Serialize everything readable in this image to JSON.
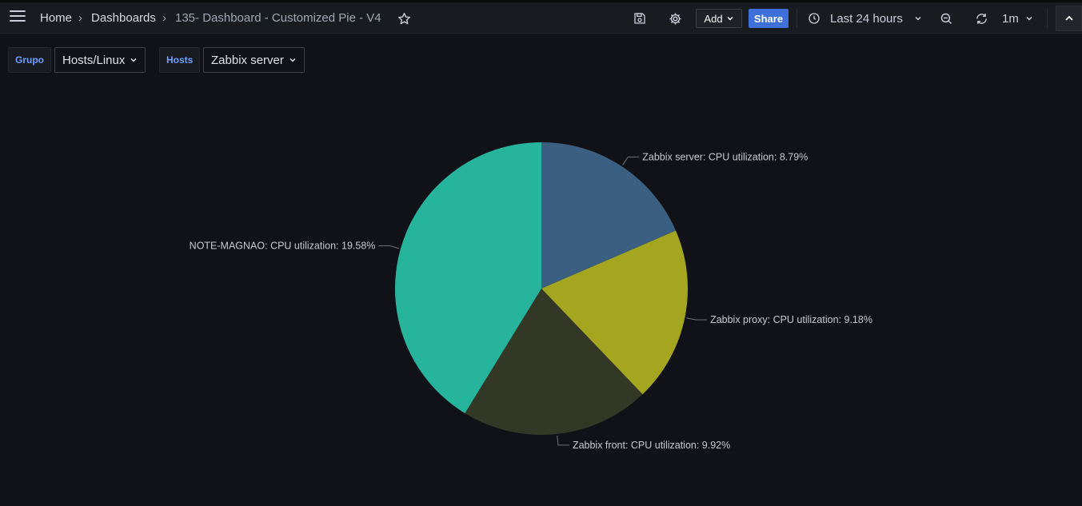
{
  "header": {
    "breadcrumb": {
      "home": "Home",
      "dashboards": "Dashboards",
      "current": "135- Dashboard - Customized Pie - V4"
    },
    "add_label": "Add",
    "share_label": "Share",
    "time_range": "Last 24 hours",
    "refresh_interval": "1m",
    "icons": [
      "menu-icon",
      "star-icon",
      "save-icon",
      "gear-icon",
      "clock-icon",
      "zoom-out-icon",
      "refresh-icon",
      "chevron-up-icon"
    ]
  },
  "variables": [
    {
      "label": "Grupo",
      "value": "Hosts/Linux"
    },
    {
      "label": "Hosts",
      "value": "Zabbix server"
    }
  ],
  "chart_data": {
    "type": "pie",
    "slices": [
      {
        "label": "Zabbix server: CPU utilization: 8.79%",
        "value": 8.79,
        "color": "#3b5f80"
      },
      {
        "label": "Zabbix proxy: CPU utilization: 9.18%",
        "value": 9.18,
        "color": "#a5a620"
      },
      {
        "label": "Zabbix front: CPU utilization: 9.92%",
        "value": 9.92,
        "color": "#333826"
      },
      {
        "label": "NOTE-MAGNAO: CPU utilization: 19.58%",
        "value": 19.58,
        "color": "#26b59c"
      }
    ],
    "legend": "none",
    "labels": "outside-with-leader-lines"
  },
  "colors": {
    "background": "#111217",
    "topbar": "#181b1f",
    "accent": "#3d71d9",
    "variable_label": "#6e9fff"
  }
}
